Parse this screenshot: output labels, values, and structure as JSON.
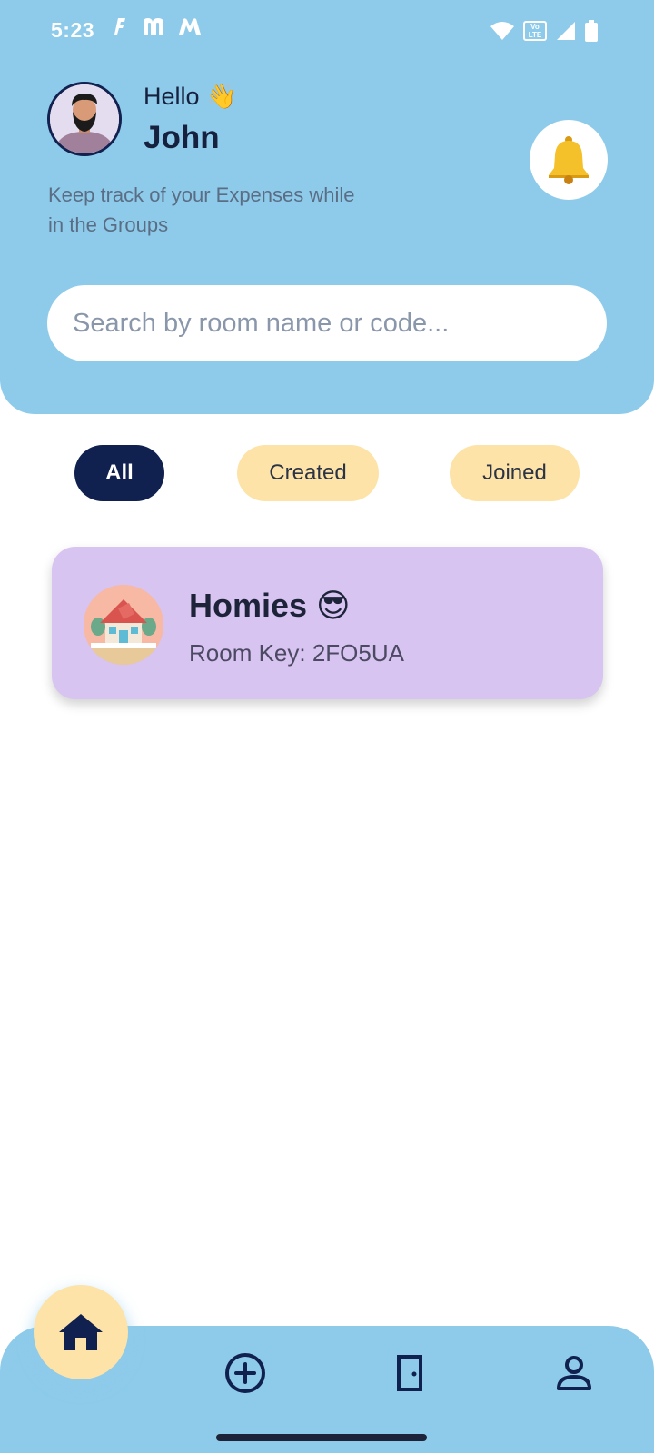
{
  "status_bar": {
    "time": "5:23",
    "app_icons": [
      "flipkart-icon",
      "myntra-icon",
      "meesho-icon"
    ],
    "network_label": "Vo LTE"
  },
  "greeting": {
    "hello": "Hello 👋",
    "name": "John",
    "subtitle": "Keep track of your Expenses while in the Groups"
  },
  "notifications": {
    "icon": "bell-icon",
    "emoji": "🔔"
  },
  "search": {
    "placeholder": "Search by room name or code...",
    "value": ""
  },
  "filters": {
    "items": [
      {
        "label": "All",
        "active": true
      },
      {
        "label": "Created",
        "active": false
      },
      {
        "label": "Joined",
        "active": false
      }
    ]
  },
  "rooms": [
    {
      "name": "Homies 😎",
      "key_label": "Room Key: 2FO5UA"
    }
  ],
  "bottom_nav": {
    "items": [
      "home-icon",
      "add-circle-icon",
      "door-icon",
      "profile-icon"
    ],
    "active": "home-icon"
  },
  "colors": {
    "header_bg": "#8ecbea",
    "accent_dark": "#10204f",
    "chip_bg": "#fde3a7",
    "card_bg": "#d8c4f1",
    "text_dark": "#16213e"
  }
}
